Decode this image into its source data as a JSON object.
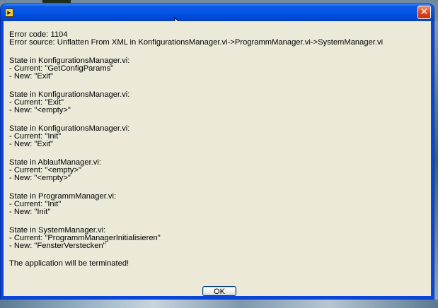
{
  "dialog": {
    "title": "",
    "close_glyph": "✕",
    "icon": "labview-app-icon",
    "lines": [
      "Error code: 1104",
      "Error source: Unflatten From XML in KonfigurationsManager.vi->ProgrammManager.vi->SystemManager.vi",
      "",
      "State in KonfigurationsManager.vi:",
      "- Current: \"GetConfigParams\"",
      "- New: \"Exit\"",
      "",
      "State in KonfigurationsManager.vi:",
      "- Current: \"Exit\"",
      "- New: \"<empty>\"",
      "",
      "State in KonfigurationsManager.vi:",
      "- Current: \"Init\"",
      "- New: \"Exit\"",
      "",
      "State in AblaufManager.vi:",
      "- Current: \"<empty>\"",
      "- New: \"<empty>\"",
      "",
      "State in ProgrammManager.vi:",
      "- Current: \"Init\"",
      "- New: \"Init\"",
      "",
      "State in SystemManager.vi:",
      "- Current: \"ProgrammManagerInitialisieren\"",
      "- New: \"FensterVerstecken\"",
      "",
      "The application will be terminated!"
    ],
    "ok_label": "OK"
  },
  "colors": {
    "titlebar": "#0554e3",
    "client_bg": "#ece9d8",
    "close_button": "#d9431d"
  }
}
